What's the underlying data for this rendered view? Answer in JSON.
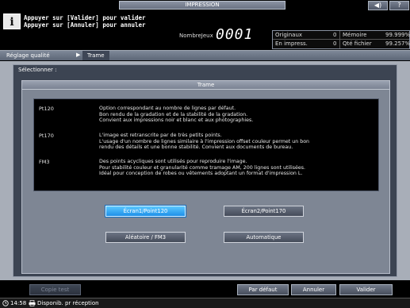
{
  "header": {
    "title": "IMPRESSION",
    "message_line1": "Appuyer sur [Valider] pour valider",
    "message_line2": "Appuyer sur [Annuler] pour annuler",
    "jobs_label": "NombreJeux",
    "jobs_value": "0001",
    "speaker_glyph": "◀)",
    "help_glyph": "?"
  },
  "counters": {
    "originals_label": "Originaux",
    "originals_value": "0",
    "memory_label": "Mémoire",
    "memory_value": "99.999%",
    "printing_label": "En impress.",
    "printing_value": "0",
    "file_qty_label": "Qté fichier",
    "file_qty_value": "99.257%"
  },
  "breadcrumb": {
    "item1": "Réglage qualité",
    "arrow": "▶",
    "item2": "Trame"
  },
  "main": {
    "select_label": "Sélectionner :",
    "panel_title": "Trame",
    "descriptions": [
      {
        "key": "Pt120",
        "lines": [
          "Option correspondant au nombre de lignes par défaut.",
          "Bon rendu de la gradation et de la stabilité de la gradation.",
          "Convient aux impressions noir et blanc et aux photographies."
        ]
      },
      {
        "key": "Pt170",
        "lines": [
          "L'image est retranscrite par de très petits points.",
          "L'usage d'un nombre de lignes similaire à l'impression offset couleur permet un bon",
          "rendu des détails et une bonne stabilité. Convient aux documents de bureau."
        ]
      },
      {
        "key": "FM3",
        "lines": [
          "Des points acycliques sont utilisés pour reproduire l'image.",
          "Pour stabilité couleur et granularité comme tramage AM, 200 lignes sont utilisées.",
          "Idéal pour conception de robes ou vêtements adoptant un format d'impression L."
        ]
      }
    ],
    "options": {
      "ecran1": "Écran1/Point120",
      "ecran2": "Écran2/Point170",
      "aleatoire": "Aléatoire / FM3",
      "automatique": "Automatique"
    }
  },
  "footer": {
    "copy_test": "Copie test",
    "default": "Par défaut",
    "cancel": "Annuler",
    "validate": "Valider"
  },
  "status": {
    "time": "14:58",
    "text": "Disponib. pr réception"
  }
}
